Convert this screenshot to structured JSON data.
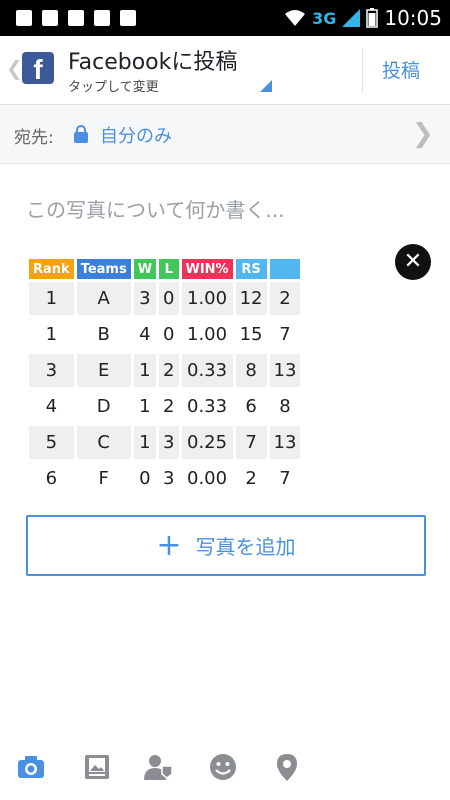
{
  "status_bar": {
    "time": "10:05",
    "network": "3G"
  },
  "header": {
    "title": "Facebookに投稿",
    "subtitle": "タップして変更",
    "post_label": "投稿",
    "logo_letter": "f"
  },
  "audience": {
    "label": "宛先:",
    "value": "自分のみ"
  },
  "composer": {
    "placeholder": "この写真について何か書く..."
  },
  "table": {
    "headers": [
      "Rank",
      "Teams",
      "W",
      "L",
      "WIN%",
      "RS",
      ""
    ],
    "header_colors": [
      "#f7a10f",
      "#3a7fdb",
      "#41c659",
      "#41c659",
      "#f0315a",
      "#52b7f0",
      "#52b7f0"
    ],
    "rows": [
      [
        "1",
        "A",
        "3",
        "0",
        "1.00",
        "12",
        "2"
      ],
      [
        "1",
        "B",
        "4",
        "0",
        "1.00",
        "15",
        "7"
      ],
      [
        "3",
        "E",
        "1",
        "2",
        "0.33",
        "8",
        "13"
      ],
      [
        "4",
        "D",
        "1",
        "2",
        "0.33",
        "6",
        "8"
      ],
      [
        "5",
        "C",
        "1",
        "3",
        "0.25",
        "7",
        "13"
      ],
      [
        "6",
        "F",
        "0",
        "3",
        "0.00",
        "2",
        "7"
      ]
    ]
  },
  "add_photo": {
    "label": "写真を追加"
  },
  "colors": {
    "accent": "#4a90e2",
    "facebook": "#3b5998"
  },
  "bottom_icons": [
    "camera-icon",
    "photo-album-icon",
    "tag-person-icon",
    "emoji-icon",
    "location-pin-icon"
  ]
}
